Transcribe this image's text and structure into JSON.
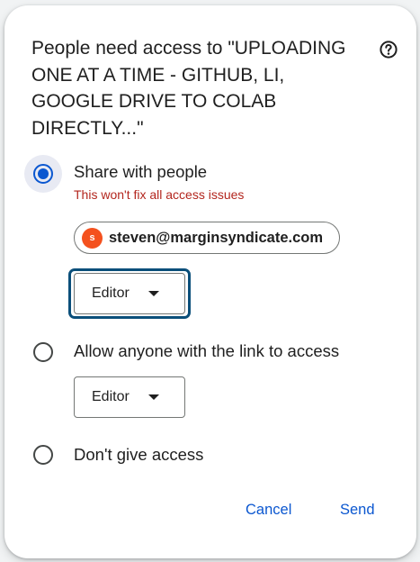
{
  "dialog": {
    "title": "People need access to \"UPLOADING ONE AT A TIME - GITHUB, LI, GOOGLE DRIVE TO COLAB DIRECTLY...\"",
    "help_icon": "help-circle-icon"
  },
  "options": {
    "share": {
      "label": "Share with people",
      "warning": "This won't fix all access issues",
      "selected": true
    },
    "anyone": {
      "label": "Allow anyone with the link to access",
      "selected": false
    },
    "none": {
      "label": "Don't give access",
      "selected": false
    }
  },
  "recipient": {
    "initial": "s",
    "email": "steven@marginsyndicate.com",
    "avatar_color": "#f4511e"
  },
  "share_role": "Editor",
  "link_role": "Editor",
  "actions": {
    "cancel": "Cancel",
    "send": "Send"
  },
  "colors": {
    "accent": "#0b57d0",
    "warning": "#b3261e",
    "focus": "#0b4f7a"
  }
}
